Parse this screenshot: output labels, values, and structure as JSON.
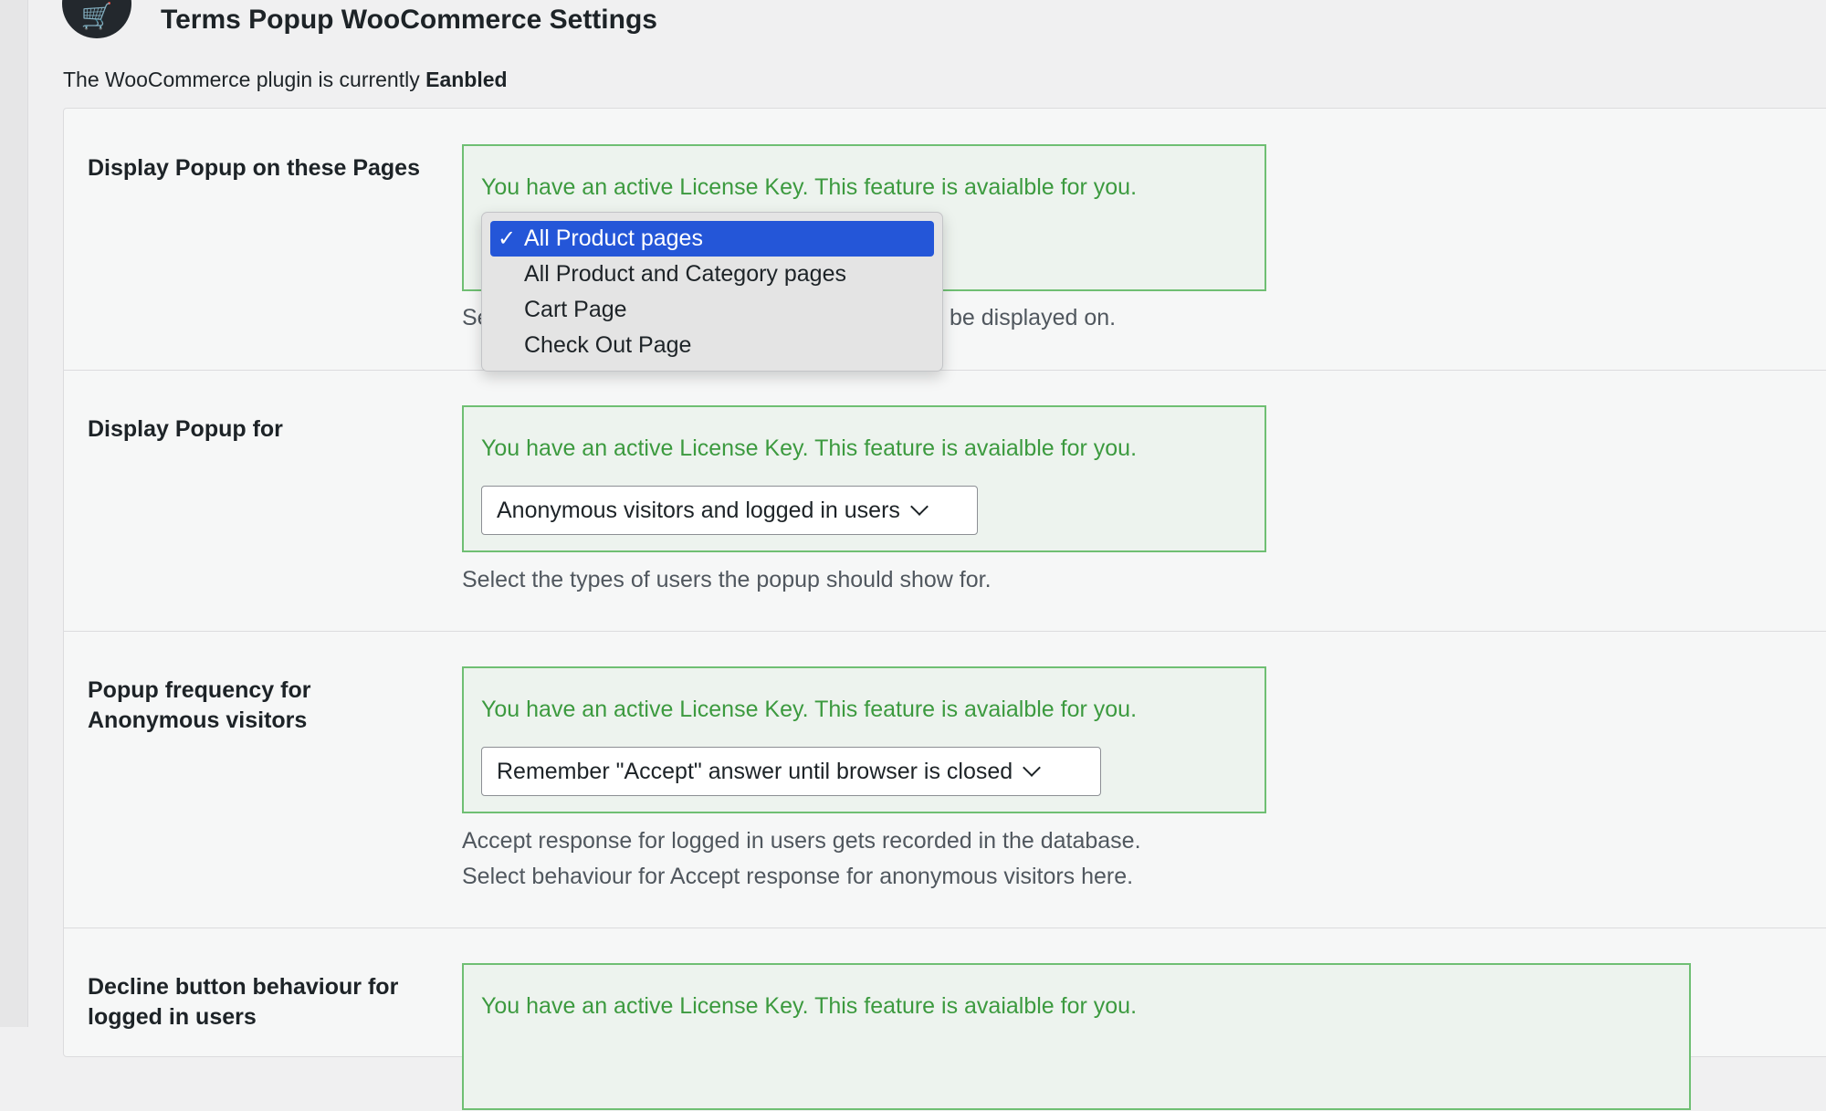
{
  "header": {
    "title": "Terms Popup WooCommerce Settings",
    "logo_icon": "cart-icon"
  },
  "status": {
    "prefix": "The WooCommerce plugin is currently",
    "value": "Eanbled"
  },
  "license_notice": "You have an active License Key. This feature is avaialble for you.",
  "rows": [
    {
      "label": "Display Popup on these Pages",
      "description_left": "Se",
      "description_right": "be displayed on."
    },
    {
      "label": "Display Popup for",
      "select_value": "Anonymous visitors and logged in users",
      "description": "Select the types of users the popup should show for."
    },
    {
      "label": "Popup frequency for Anonymous visitors",
      "select_value": "Remember \"Accept\" answer until browser is closed",
      "description_line1": "Accept response for logged in users gets recorded in the database.",
      "description_line2": "Select behaviour for Accept response for anonymous visitors here."
    },
    {
      "label": "Decline button behaviour for logged in users"
    }
  ],
  "pages_dropdown": {
    "check_glyph": "✓",
    "options": [
      {
        "label": "All Product pages",
        "selected": true
      },
      {
        "label": "All Product and Category pages",
        "selected": false
      },
      {
        "label": "Cart Page",
        "selected": false
      },
      {
        "label": "Check Out Page",
        "selected": false
      }
    ]
  },
  "colors": {
    "notice_text": "#3c9a3f",
    "notice_border": "#6fbf73",
    "notice_bg": "#edf3ee",
    "selected_option": "#2456d8"
  }
}
